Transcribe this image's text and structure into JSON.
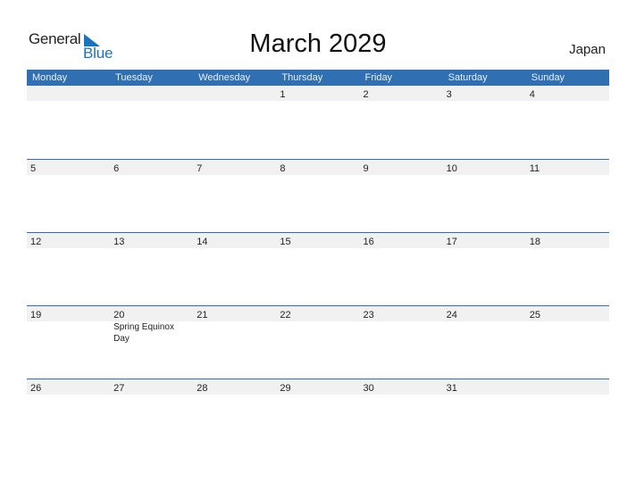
{
  "logo": {
    "part1": "General",
    "part2": "Blue"
  },
  "title": "March 2029",
  "country": "Japan",
  "weekdays": [
    "Monday",
    "Tuesday",
    "Wednesday",
    "Thursday",
    "Friday",
    "Saturday",
    "Sunday"
  ],
  "weeks": [
    {
      "days": [
        "",
        "",
        "",
        "1",
        "2",
        "3",
        "4"
      ],
      "events": [
        "",
        "",
        "",
        "",
        "",
        "",
        ""
      ]
    },
    {
      "days": [
        "5",
        "6",
        "7",
        "8",
        "9",
        "10",
        "11"
      ],
      "events": [
        "",
        "",
        "",
        "",
        "",
        "",
        ""
      ]
    },
    {
      "days": [
        "12",
        "13",
        "14",
        "15",
        "16",
        "17",
        "18"
      ],
      "events": [
        "",
        "",
        "",
        "",
        "",
        "",
        ""
      ]
    },
    {
      "days": [
        "19",
        "20",
        "21",
        "22",
        "23",
        "24",
        "25"
      ],
      "events": [
        "",
        "Spring Equinox Day",
        "",
        "",
        "",
        "",
        ""
      ]
    },
    {
      "days": [
        "26",
        "27",
        "28",
        "29",
        "30",
        "31",
        ""
      ],
      "events": [
        "",
        "",
        "",
        "",
        "",
        "",
        ""
      ]
    }
  ],
  "colors": {
    "header": "#2f6fb2",
    "brand_blue": "#1a73c0",
    "day_strip": "#f1f1f1"
  }
}
